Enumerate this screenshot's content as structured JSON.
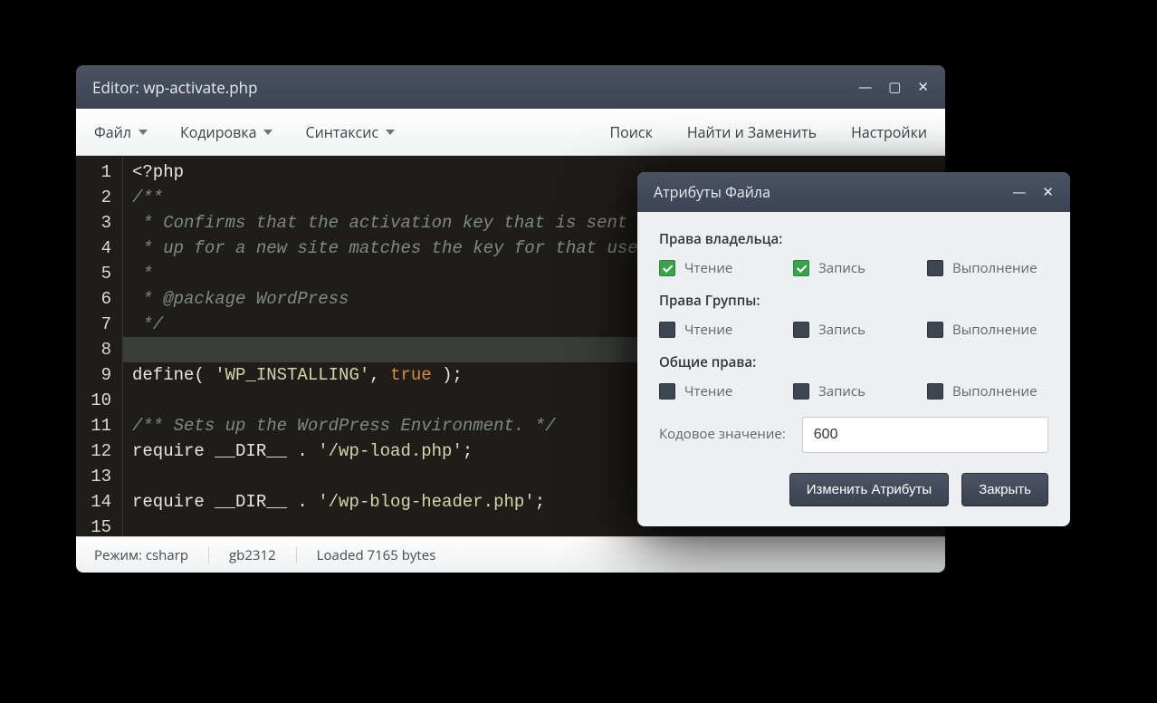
{
  "editor": {
    "title": "Editor: wp-activate.php",
    "menu_left": [
      {
        "label": "Файл",
        "has_caret": true
      },
      {
        "label": "Кодировка",
        "has_caret": true
      },
      {
        "label": "Синтаксис",
        "has_caret": true
      }
    ],
    "menu_right": [
      {
        "label": "Поиск"
      },
      {
        "label": "Найти и Заменить"
      },
      {
        "label": "Настройки"
      }
    ],
    "lines": [
      {
        "n": 1,
        "tokens": [
          {
            "t": "<?php",
            "c": "tok-def"
          }
        ]
      },
      {
        "n": 2,
        "tokens": [
          {
            "t": "/**",
            "c": "tok-com"
          }
        ]
      },
      {
        "n": 3,
        "tokens": [
          {
            "t": " * Confirms that the activation key that is sent in an email after a user signs",
            "c": "tok-com"
          }
        ]
      },
      {
        "n": 4,
        "tokens": [
          {
            "t": " * up for a new site matches the key for that user and then displays confirmation.",
            "c": "tok-com"
          }
        ]
      },
      {
        "n": 5,
        "tokens": [
          {
            "t": " *",
            "c": "tok-com"
          }
        ]
      },
      {
        "n": 6,
        "tokens": [
          {
            "t": " * @package WordPress",
            "c": "tok-com"
          }
        ]
      },
      {
        "n": 7,
        "tokens": [
          {
            "t": " */",
            "c": "tok-com"
          }
        ]
      },
      {
        "n": 8,
        "current": true,
        "tokens": [
          {
            "t": "",
            "c": "tok-def"
          }
        ]
      },
      {
        "n": 9,
        "tokens": [
          {
            "t": "define( ",
            "c": "tok-def"
          },
          {
            "t": "'WP_INSTALLING'",
            "c": "tok-str"
          },
          {
            "t": ", ",
            "c": "tok-def"
          },
          {
            "t": "true",
            "c": "tok-kw"
          },
          {
            "t": " );",
            "c": "tok-def"
          }
        ]
      },
      {
        "n": 10,
        "tokens": [
          {
            "t": "",
            "c": "tok-def"
          }
        ]
      },
      {
        "n": 11,
        "tokens": [
          {
            "t": "/** Sets up the WordPress Environment. */",
            "c": "tok-com"
          }
        ]
      },
      {
        "n": 12,
        "tokens": [
          {
            "t": "require __DIR__ . ",
            "c": "tok-def"
          },
          {
            "t": "'/wp-load.php'",
            "c": "tok-str"
          },
          {
            "t": ";",
            "c": "tok-def"
          }
        ]
      },
      {
        "n": 13,
        "tokens": [
          {
            "t": "",
            "c": "tok-def"
          }
        ]
      },
      {
        "n": 14,
        "tokens": [
          {
            "t": "require __DIR__ . ",
            "c": "tok-def"
          },
          {
            "t": "'/wp-blog-header.php'",
            "c": "tok-str"
          },
          {
            "t": ";",
            "c": "tok-def"
          }
        ]
      },
      {
        "n": 15,
        "tokens": [
          {
            "t": "",
            "c": "tok-def"
          }
        ]
      }
    ],
    "status": {
      "mode_label": "Режим: csharp",
      "encoding": "gb2312",
      "loaded": "Loaded 7165 bytes"
    }
  },
  "dialog": {
    "title": "Атрибуты Файла",
    "sections": [
      {
        "title": "Права владельца:",
        "perms": [
          {
            "label": "Чтение",
            "checked": true
          },
          {
            "label": "Запись",
            "checked": true
          },
          {
            "label": "Выполнение",
            "checked": false
          }
        ]
      },
      {
        "title": "Права Группы:",
        "perms": [
          {
            "label": "Чтение",
            "checked": false
          },
          {
            "label": "Запись",
            "checked": false
          },
          {
            "label": "Выполнение",
            "checked": false
          }
        ]
      },
      {
        "title": "Общие права:",
        "perms": [
          {
            "label": "Чтение",
            "checked": false
          },
          {
            "label": "Запись",
            "checked": false
          },
          {
            "label": "Выполнение",
            "checked": false
          }
        ]
      }
    ],
    "code_label": "Кодовое значение:",
    "code_value": "600",
    "apply_label": "Изменить Атрибуты",
    "close_label": "Закрыть"
  }
}
